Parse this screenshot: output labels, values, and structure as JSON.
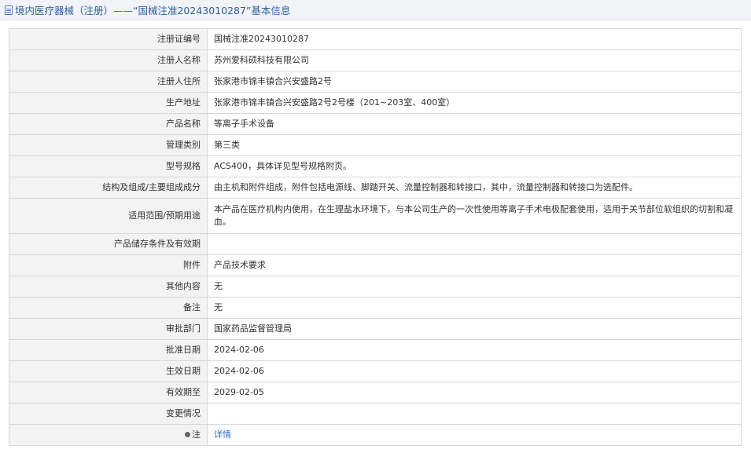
{
  "header": {
    "title": "境内医疗器械（注册）——“国械注准20243010287”基本信息"
  },
  "rows": [
    {
      "label": "注册证编号",
      "value": "国械注准20243010287"
    },
    {
      "label": "注册人名称",
      "value": "苏州爱科硕科技有限公司"
    },
    {
      "label": "注册人住所",
      "value": "张家港市锦丰镇合兴安盛路2号"
    },
    {
      "label": "生产地址",
      "value": "张家港市锦丰镇合兴安盛路2号2号楼（201~203室、400室）"
    },
    {
      "label": "产品名称",
      "value": "等离子手术设备"
    },
    {
      "label": "管理类别",
      "value": "第三类"
    },
    {
      "label": "型号规格",
      "value": "ACS400，具体详见型号规格附页。"
    },
    {
      "label": "结构及组成/主要组成成分",
      "value": "由主机和附件组成，附件包括电源线、脚踏开关、流量控制器和转接口，其中，流量控制器和转接口为选配件。"
    },
    {
      "label": "适用范围/预期用途",
      "value": "本产品在医疗机构内使用，在生理盐水环境下，与本公司生产的一次性使用等离子手术电极配套使用，适用于关节部位软组织的切割和凝血。"
    },
    {
      "label": "产品储存条件及有效期",
      "value": ""
    },
    {
      "label": "附件",
      "value": "产品技术要求"
    },
    {
      "label": "其他内容",
      "value": "无"
    },
    {
      "label": "备注",
      "value": "无"
    },
    {
      "label": "审批部门",
      "value": "国家药品监督管理局"
    },
    {
      "label": "批准日期",
      "value": "2024-02-06"
    },
    {
      "label": "生效日期",
      "value": "2024-02-06"
    },
    {
      "label": "有效期至",
      "value": "2029-02-05"
    },
    {
      "label": "变更情况",
      "value": ""
    },
    {
      "label": "注",
      "value": "详情"
    }
  ]
}
